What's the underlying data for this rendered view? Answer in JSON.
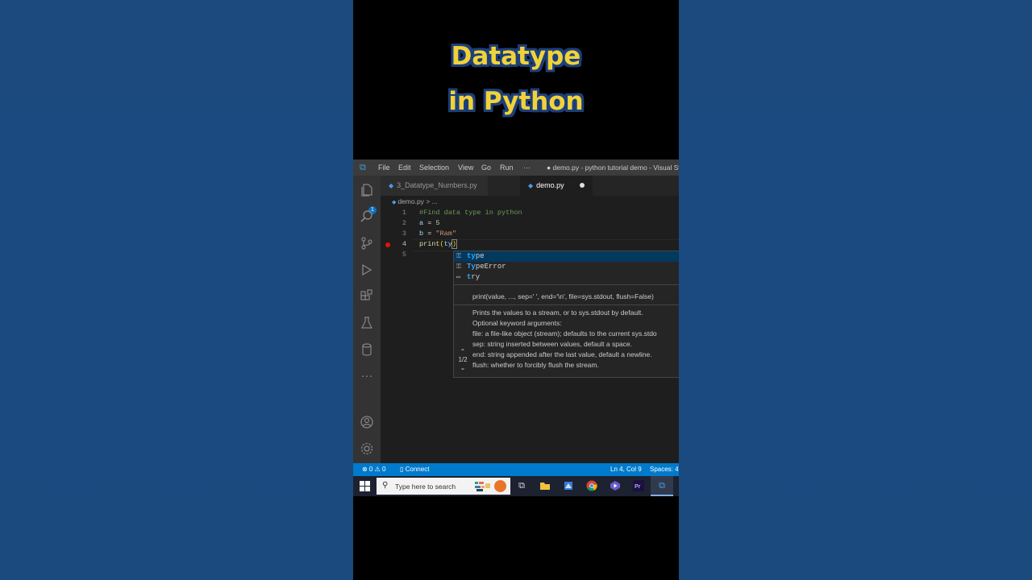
{
  "overlay_title": {
    "line1": "Datatype",
    "line2": "in Python"
  },
  "window": {
    "title": "● demo.py - python tutorial demo - Visual St",
    "menu": [
      "File",
      "Edit",
      "Selection",
      "View",
      "Go",
      "Run",
      "···"
    ]
  },
  "activity_bar": {
    "items": [
      "explorer-icon",
      "search-icon",
      "source-control-icon",
      "run-debug-icon",
      "extensions-icon",
      "testing-icon",
      "database-icon",
      "more-icon"
    ],
    "explorer_badge": "1",
    "bottom": [
      "accounts-icon",
      "manage-gear-icon"
    ]
  },
  "tabs": [
    {
      "label": "3_Datatype_Numbers.py",
      "active": false
    },
    {
      "label": "demo.py",
      "active": true,
      "modified": true
    }
  ],
  "breadcrumb": {
    "file": "demo.py",
    "sep": ">",
    "rest": "..."
  },
  "editor": {
    "lines": [
      {
        "n": "1",
        "text": "#Find data type in python"
      },
      {
        "n": "2",
        "text": "a = 5"
      },
      {
        "n": "3",
        "text": "b = \"Ram\""
      },
      {
        "n": "4",
        "text": "print(ty)"
      },
      {
        "n": "5",
        "text": ""
      }
    ],
    "breakpoint_line": "4"
  },
  "suggestions": [
    {
      "prefix": "ty",
      "rest": "pe",
      "selected": true
    },
    {
      "prefix": "Ty",
      "rest": "peError",
      "selected": false
    },
    {
      "prefix": "t",
      "rest": "ry",
      "selected": false
    }
  ],
  "signature_help": {
    "signature": "print(value, ..., sep=' ', end='\\n', file=sys.stdout, flush=False)",
    "doc": [
      "Prints the values to a stream, or to sys.stdout by default.",
      "Optional keyword arguments:",
      "file: a file-like object (stream); defaults to the current sys.stdo",
      "sep: string inserted between values, default a space.",
      "end: string appended after the last value, default a newline.",
      "flush: whether to forcibly flush the stream."
    ],
    "pager": "1/2"
  },
  "status_bar": {
    "problems": "⊗ 0 ⚠ 0",
    "connect": "Connect",
    "position": "Ln 4, Col 9",
    "spaces": "Spaces: 4"
  },
  "taskbar": {
    "search_placeholder": "Type here to search"
  },
  "colors": {
    "title_text": "#f0d23a",
    "statusbar": "#007acc",
    "breakpoint": "#e51400",
    "comment": "#6a9955",
    "string": "#ce9178",
    "number": "#b5cea8"
  }
}
